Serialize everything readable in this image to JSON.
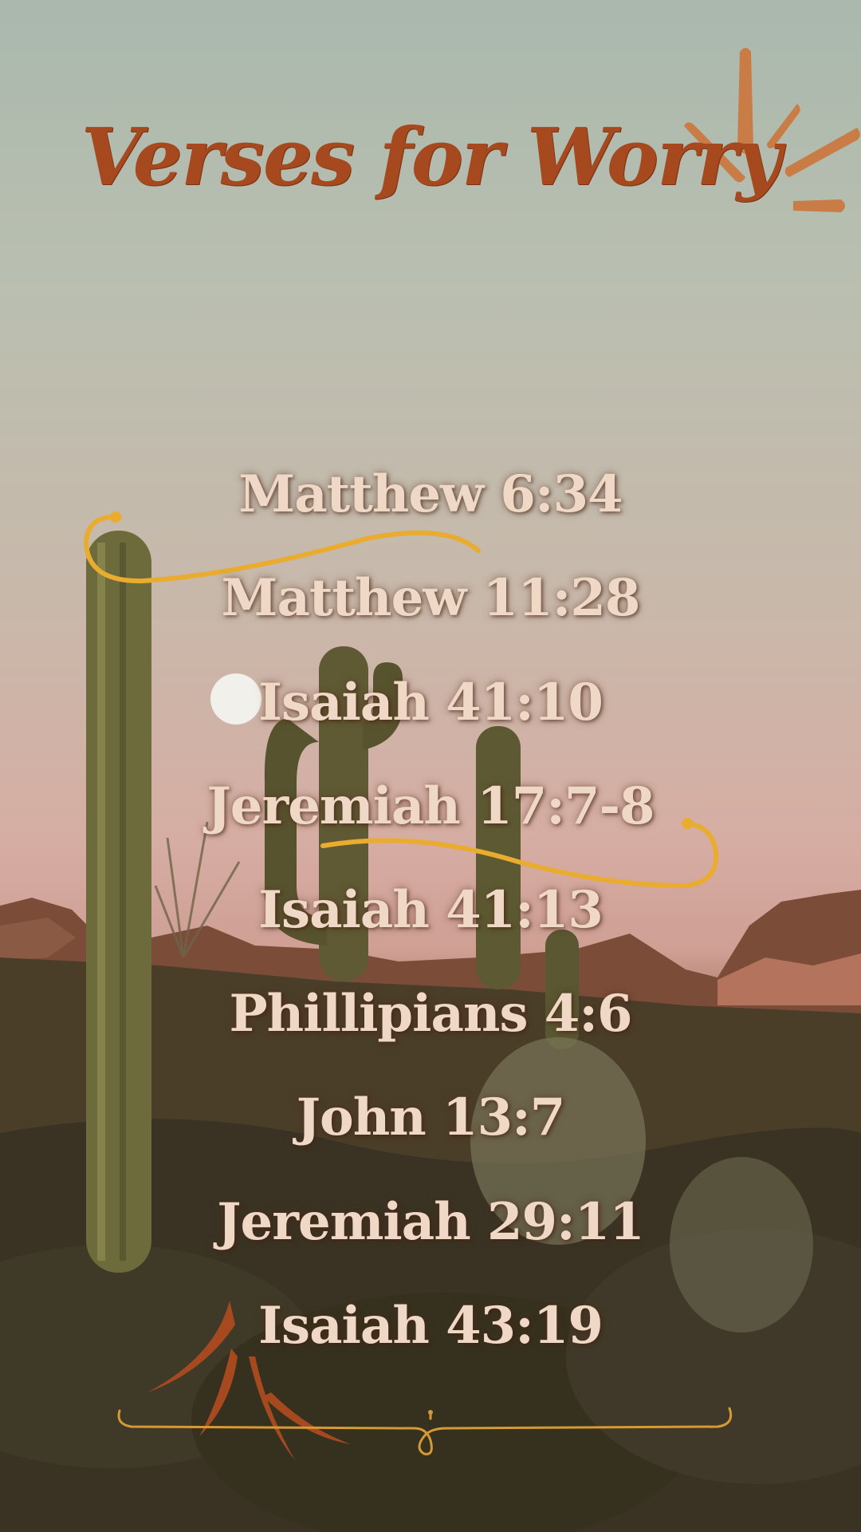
{
  "title": "Verses for Worry",
  "verses": [
    "Matthew 6:34",
    "Matthew 11:28",
    "Isaiah 41:10",
    "Jeremiah 17:7-8",
    "Isaiah 41:13",
    "Phillipians 4:6",
    "John 13:7",
    "Jeremiah 29:11",
    "Isaiah 43:19"
  ],
  "colors": {
    "title": "#a7491f",
    "verse_text": "#f0d8c6",
    "swirl_gold": "#e9ac2e",
    "sunburst": "#c97c45",
    "moon": "#f2f0ea"
  }
}
